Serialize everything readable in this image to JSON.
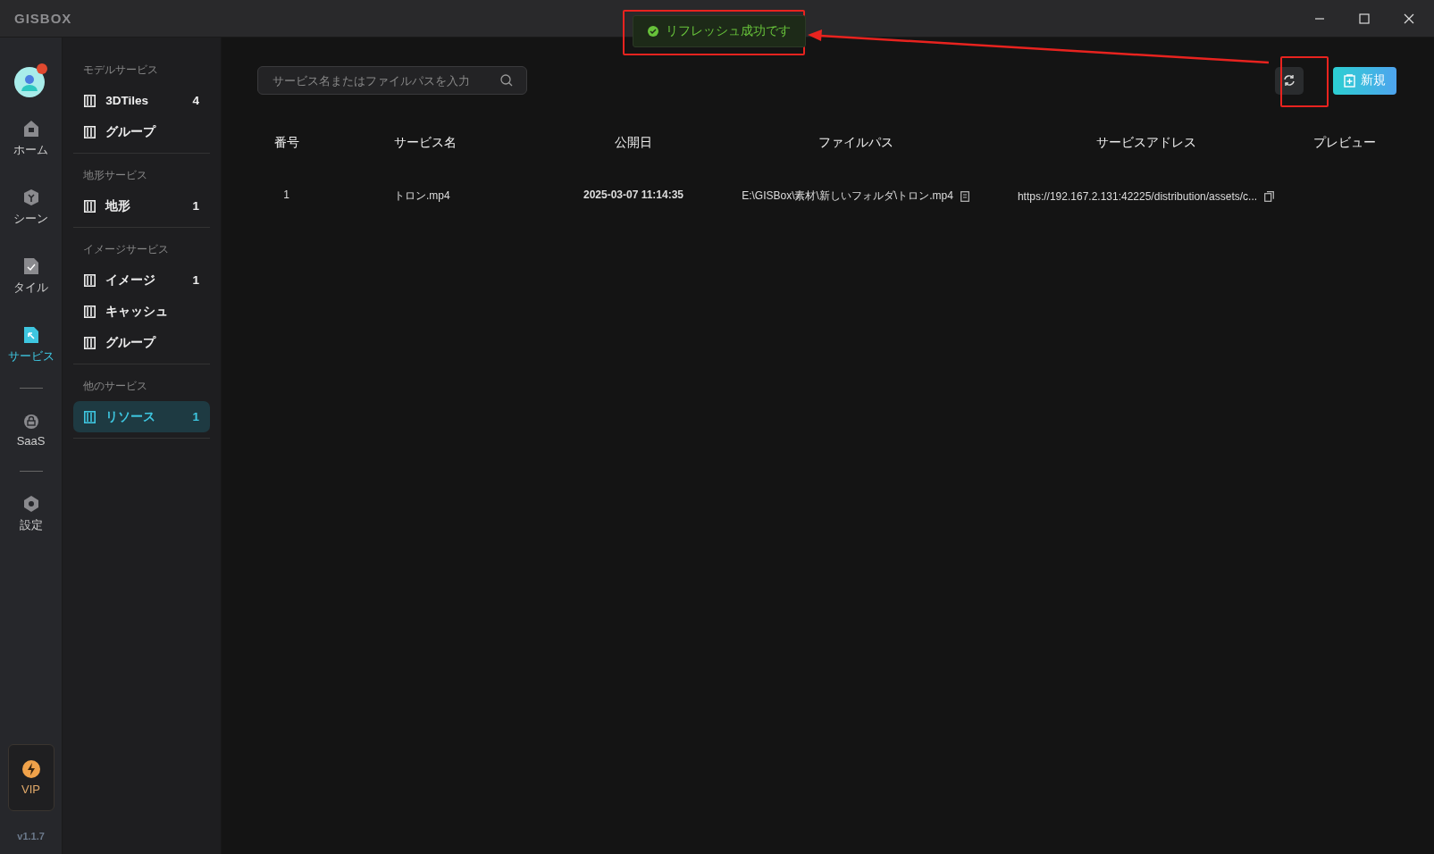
{
  "app_title": "GISBOX",
  "toast": {
    "message": "リフレッシュ成功です"
  },
  "rail": [
    {
      "label": "ホーム",
      "selected": false
    },
    {
      "label": "シーン",
      "selected": false
    },
    {
      "label": "タイル",
      "selected": false
    },
    {
      "label": "サービス",
      "selected": true
    },
    {
      "label": "SaaS",
      "selected": false
    },
    {
      "label": "設定",
      "selected": false
    }
  ],
  "vip": {
    "label": "VIP"
  },
  "version": "v1.1.7",
  "sections": [
    {
      "title": "モデルサービス",
      "items": [
        {
          "label": "3DTiles",
          "count": "4",
          "selected": false
        },
        {
          "label": "グループ",
          "selected": false
        }
      ]
    },
    {
      "title": "地形サービス",
      "items": [
        {
          "label": "地形",
          "count": "1",
          "selected": false
        }
      ]
    },
    {
      "title": "イメージサービス",
      "items": [
        {
          "label": "イメージ",
          "count": "1",
          "selected": false
        },
        {
          "label": "キャッシュ",
          "selected": false
        },
        {
          "label": "グループ",
          "selected": false
        }
      ]
    },
    {
      "title": "他のサービス",
      "items": [
        {
          "label": "リソース",
          "count": "1",
          "selected": true
        }
      ]
    }
  ],
  "search": {
    "placeholder": "サービス名またはファイルパスを入力"
  },
  "new_button": "新規",
  "table": {
    "columns": [
      "番号",
      "サービス名",
      "公開日",
      "ファイルパス",
      "サービスアドレス",
      "プレビュー"
    ],
    "rows": [
      {
        "no": "1",
        "name": "トロン.mp4",
        "date": "2025-03-07 11:14:35",
        "path": "E:\\GISBox\\素材\\新しいフォルダ\\トロン.mp4",
        "address": "https://192.167.2.131:42225/distribution/assets/c..."
      }
    ]
  }
}
